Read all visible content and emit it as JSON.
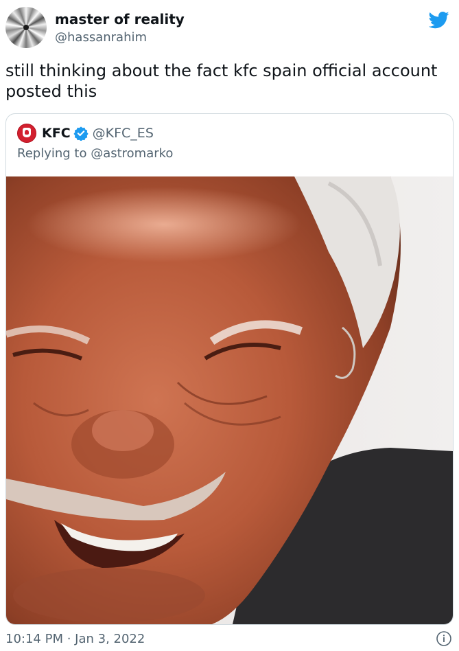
{
  "author": {
    "display_name": "master of reality",
    "handle": "@hassanrahim"
  },
  "tweet": {
    "text": "still thinking about the fact kfc spain official account posted this",
    "timestamp": "10:14 PM · Jan 3, 2022"
  },
  "quoted": {
    "name": "KFC",
    "handle": "@KFC_ES",
    "reply_context": "Replying to @astromarko",
    "verified": true
  },
  "colors": {
    "brand_blue": "#1d9bf0",
    "kfc_red": "#d2202f",
    "muted_text": "#536471",
    "border": "#cfd9de"
  },
  "icons": {
    "brand": "twitter-bird-icon",
    "verified": "verified-badge-icon",
    "info": "info-icon"
  }
}
